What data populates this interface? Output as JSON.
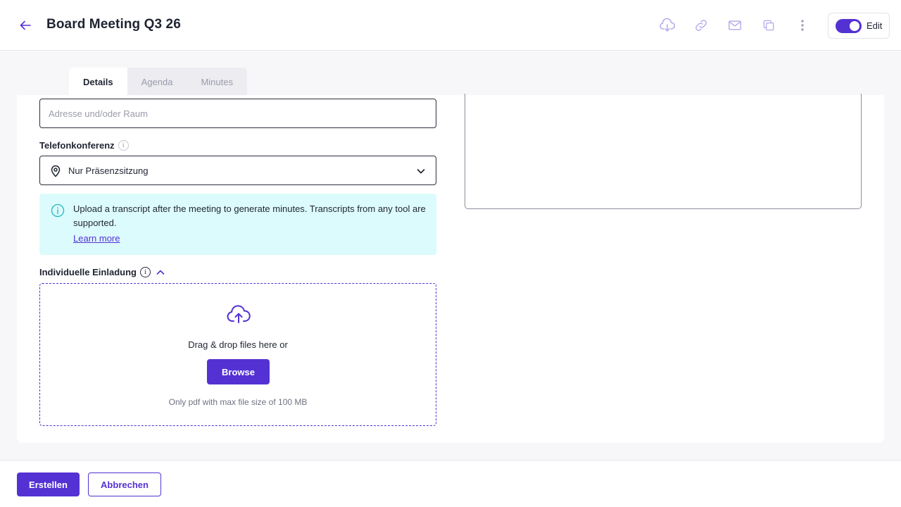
{
  "header": {
    "title": "Board Meeting Q3 26",
    "icons": [
      "back-arrow-icon",
      "cloud-download-icon",
      "link-icon",
      "mail-icon",
      "copy-icon",
      "more-vertical-icon"
    ],
    "edit_label": "Edit",
    "edit_toggle_on": true
  },
  "tabs": [
    {
      "label": "Details",
      "active": true
    },
    {
      "label": "Agenda",
      "active": false
    },
    {
      "label": "Minutes",
      "active": false
    }
  ],
  "form": {
    "address": {
      "value": "",
      "placeholder": "Adresse und/oder Raum"
    },
    "phone_conference": {
      "label": "Telefonkonferenz",
      "selected": "Nur Präsenzsitzung",
      "icon": "map-pin-icon"
    },
    "notice": {
      "text": "Upload a transcript after the meeting to generate minutes. Transcripts from any tool are supported.",
      "link": "Learn more"
    },
    "invitation": {
      "label": "Individuelle Einladung",
      "dropzone_text": "Drag & drop files here or",
      "browse_label": "Browse",
      "hint": "Only pdf with max file size of 100 MB"
    }
  },
  "footer": {
    "create_label": "Erstellen",
    "cancel_label": "Abbrechen"
  },
  "colors": {
    "accent": "#5431d3",
    "notice_bg": "#dcfbfc",
    "notice_icon": "#22b8c8",
    "text": "#1f2432",
    "muted": "#9a9cab"
  }
}
